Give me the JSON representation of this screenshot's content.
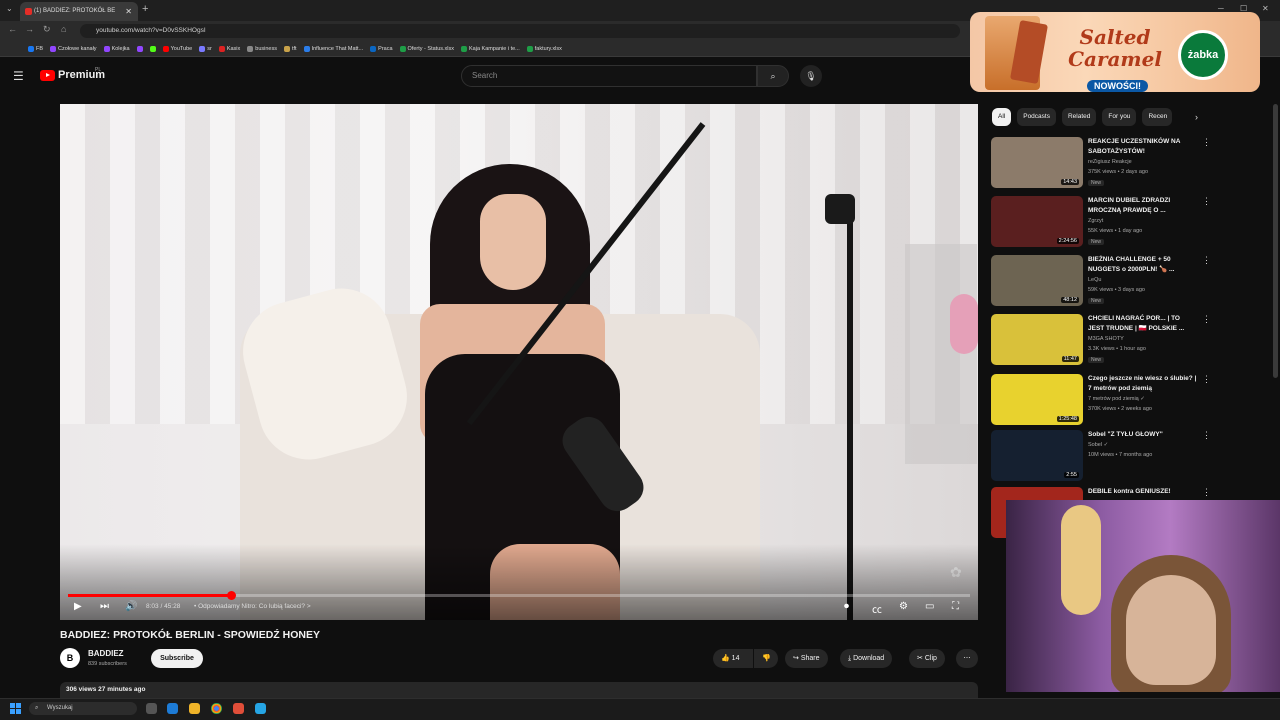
{
  "browser": {
    "tab_title": "(1) BADDIEZ: PROTOKÓŁ BE",
    "url": "youtube.com/watch?v=D0vSSKHOgsI",
    "bookmarks": [
      "FB",
      "Czołowe kanały",
      "Kolejka",
      "",
      "",
      "YouTube",
      "sr",
      "Kasix",
      "business",
      "tft",
      "Influence That Matt...",
      "Praca",
      "Oferty - Status.xlsx",
      "Kaja Kampanie i te...",
      "faktury.xlsx"
    ]
  },
  "header": {
    "logo_text": "Premium",
    "region": "PL",
    "search_placeholder": "Search"
  },
  "ad": {
    "title": "Salted Caramel",
    "badge": "NOWOŚCI!",
    "brand": "żabka"
  },
  "player": {
    "time": "8:03 / 45:28",
    "chapter": "• Odpowiadamy Nitro: Co lubią faceci? >",
    "progress": 0.181
  },
  "video": {
    "title": "BADDIEZ: PROTOKÓŁ BERLIN - SPOWIEDŹ HONEY",
    "channel": "BADDIEZ",
    "subscribers": "839 subscribers",
    "subscribe_label": "Subscribe",
    "likes": "14",
    "share_label": "Share",
    "download_label": "Download",
    "clip_label": "Clip",
    "views_age": "306 views  27 minutes ago"
  },
  "chips": [
    "All",
    "Podcasts",
    "Related",
    "For you",
    "Recen"
  ],
  "recommendations": [
    {
      "title": "REAKCJE UCZESTNIKÓW NA SABOTAŻYSTÓW!",
      "channel": "reZigiusz Reakcje",
      "meta": "375K views • 2 days ago",
      "duration": "14:43",
      "badge": "New",
      "thumb_color": "#8c7b6a"
    },
    {
      "title": "MARCIN DUBIEL ZDRADZI MROCZNĄ PRAWDĘ O ...",
      "channel": "Zgrzyt",
      "meta": "55K views • 1 day ago",
      "duration": "2:24:56",
      "badge": "New",
      "thumb_color": "#5a1f1f"
    },
    {
      "title": "BIEŻNIA CHALLENGE + 50 NUGGETS o 2000PLN! 🍗 ...",
      "channel": "LeQu",
      "meta": "59K views • 3 days ago",
      "duration": "48:12",
      "badge": "New",
      "thumb_color": "#6d6452"
    },
    {
      "title": "CHCIELI NAGRAĆ POR... | TO JEST TRUDNE | 🇵🇱 POLSKIE ...",
      "channel": "M3GA SHOTY",
      "meta": "3.3K views • 1 hour ago",
      "duration": "11:47",
      "badge": "New",
      "thumb_color": "#d9c13a"
    },
    {
      "title": "Czego jeszcze nie wiesz o ślubie? | 7 metrów pod ziemią",
      "channel": "7 metrów pod ziemią ✓",
      "meta": "370K views • 2 weeks ago",
      "duration": "1:25:48",
      "badge": "",
      "thumb_color": "#e8d22e"
    },
    {
      "title": "Sobel \"Z TYŁU GŁOWY\"",
      "channel": "Sobel ✓",
      "meta": "10M views • 7 months ago",
      "duration": "2:55",
      "badge": "",
      "thumb_color": "#152030"
    },
    {
      "title": "DEBILE kontra GENIUSZE!",
      "channel": "",
      "meta": "",
      "duration": "",
      "badge": "",
      "thumb_color": "#a3261c"
    }
  ],
  "taskbar": {
    "search_placeholder": "Wyszukaj"
  }
}
